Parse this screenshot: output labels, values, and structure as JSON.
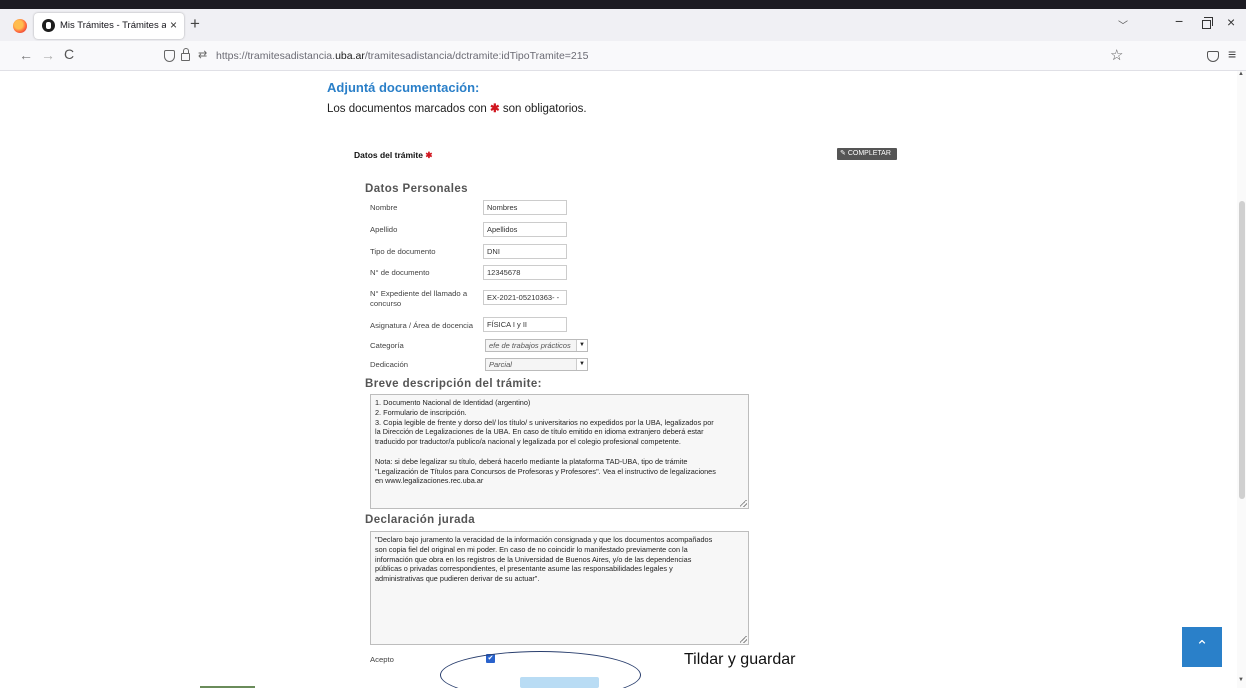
{
  "browser": {
    "tab_title": "Mis Trámites - Trámites a Distan",
    "tab_close": "×",
    "new_tab": "+",
    "tab_list": "﹀",
    "url_prefix": "https://tramitesadistancia.",
    "url_domain": "uba.ar",
    "url_path": "/tramitesadistancia/dctramite:idTipoTramite=215",
    "icons": {
      "back": "←",
      "forward": "→",
      "reload": "C",
      "bookmark": "☆",
      "menu": "≡",
      "minimize": "−",
      "close": "×",
      "permissions": "⇄"
    }
  },
  "header": {
    "title": "Adjuntá documentación:",
    "required_prefix": "Los documentos marcados con",
    "required_mark": "✱",
    "required_suffix": "son obligatorios."
  },
  "tramite": {
    "label": "Datos del trámite",
    "required_mark": "✱",
    "completar_label": "COMPLETAR",
    "completar_icon": "✎"
  },
  "datos_personales": {
    "title": "Datos Personales",
    "fields": [
      {
        "label": "Nombre",
        "value": "Nombres"
      },
      {
        "label": "Apellido",
        "value": "Apellidos"
      },
      {
        "label": "Tipo de documento",
        "value": "DNI"
      },
      {
        "label": "N° de documento",
        "value": "12345678"
      },
      {
        "label": "N° Expediente del llamado a concurso",
        "value": "EX-2021-05210363- -"
      },
      {
        "label": "Asignatura / Área de docencia",
        "value": "FÍSICA I y II"
      }
    ],
    "selects": [
      {
        "label": "Categoría",
        "value": "efe de trabajos prácticos"
      },
      {
        "label": "Dedicación",
        "value": "Parcial"
      }
    ],
    "select_arrow": "▼"
  },
  "descripcion": {
    "title": "Breve descripción del trámite:",
    "lines": [
      "1. Documento Nacional de Identidad (argentino)",
      "2. Formulario de inscripción.",
      "3. Copia legible de frente y dorso del/ los título/ s universitarios no expedidos por la UBA, legalizados por",
      "la Dirección de Legalizaciones de la UBA. En caso de título emitido en idioma extranjero deberá estar",
      "traducido por traductor/a publico/a nacional y legalizada por el colegio profesional competente.",
      "",
      "Nota: si debe legalizar su título,  deberá hacerlo mediante la plataforma TAD-UBA, tipo de trámite",
      "\"Legalización de Títulos para Concursos de Profesoras y Profesores\". Vea el instructivo de legalizaciones",
      "en  www.legalizaciones.rec.uba.ar"
    ]
  },
  "declaracion": {
    "title": "Declaración jurada",
    "lines": [
      "\"Declaro bajo juramento la veracidad de la información consignada y que los documentos acompañados",
      "son copia fiel del original en mi poder. En caso de no coincidir lo manifestado previamente con la",
      "información que obra en los registros de la Universidad de Buenos Aires, y/o de las dependencias",
      "públicas o privadas correspondientes, el presentante asume las responsabilidades legales y",
      "administrativas que pudieren derivar de su actuar\"."
    ]
  },
  "acepto": {
    "label": "Acepto",
    "checked": "✔"
  },
  "annotation": {
    "text": "Tildar y guardar"
  },
  "scroll_top": {
    "label": "⌃"
  }
}
